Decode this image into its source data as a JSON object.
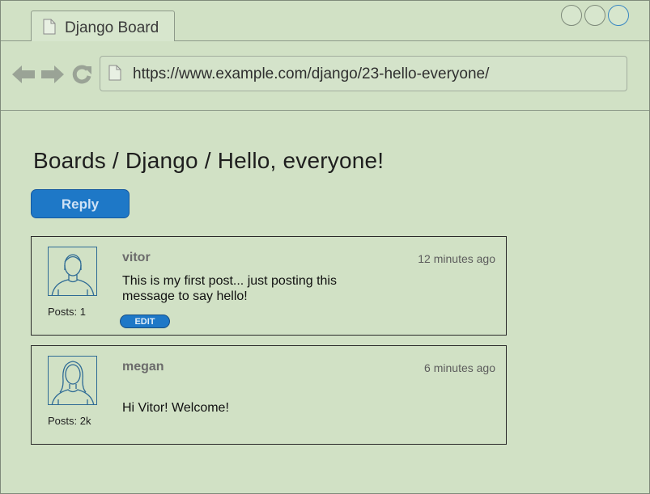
{
  "browser": {
    "tab_title": "Django Board",
    "url": "https://www.example.com/django/23-hello-everyone/",
    "window_controls": [
      "circle-icon",
      "circle-icon",
      "circle-icon"
    ],
    "nav_icons": [
      "back-arrow-icon",
      "forward-arrow-icon",
      "refresh-icon"
    ]
  },
  "page": {
    "title": "Boards / Django / Hello, everyone!",
    "reply_label": "Reply"
  },
  "posts": [
    {
      "username": "vitor",
      "time": "12 minutes ago",
      "message": "This is my first post... just posting this message to say hello!",
      "posts_count": "Posts: 1",
      "edit_label": "EDIT",
      "avatar": "male-avatar-icon"
    },
    {
      "username": "megan",
      "time": "6 minutes ago",
      "message": "Hi Vitor! Welcome!",
      "posts_count": "Posts: 2k",
      "avatar": "female-avatar-icon"
    }
  ],
  "colors": {
    "background": "#d1e1c5",
    "primary": "#1e78c7",
    "border": "#2a2a2a",
    "active_circle": "#3a87c2"
  }
}
